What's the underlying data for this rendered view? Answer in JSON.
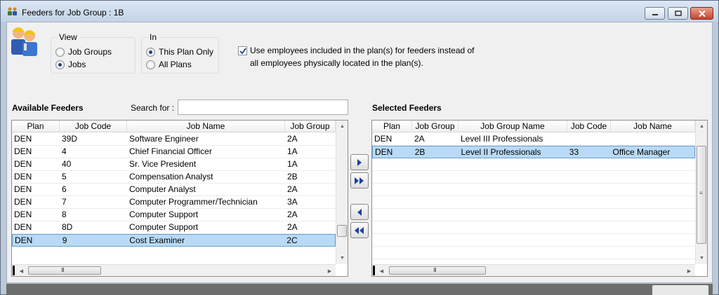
{
  "window": {
    "title": "Feeders for Job Group : 1B"
  },
  "view_group": {
    "title": "View",
    "options": [
      {
        "label": "Job Groups",
        "selected": false
      },
      {
        "label": "Jobs",
        "selected": true
      }
    ]
  },
  "in_group": {
    "title": "In",
    "options": [
      {
        "label": "This Plan Only",
        "selected": true
      },
      {
        "label": "All Plans",
        "selected": false
      }
    ]
  },
  "use_employees": {
    "checked": true,
    "line1": "Use employees included in the plan(s) for feeders instead of",
    "line2": "all employees physically located in the plan(s)."
  },
  "available": {
    "label": "Available Feeders",
    "search_label": "Search for :",
    "search_value": "",
    "columns": [
      "Plan",
      "Job Code",
      "Job Name",
      "Job Group"
    ],
    "rows": [
      {
        "plan": "DEN",
        "job_code": "39D",
        "job_name": "Software Engineer",
        "job_group": "2A",
        "selected": false
      },
      {
        "plan": "DEN",
        "job_code": "4",
        "job_name": "Chief Financial Officer",
        "job_group": "1A",
        "selected": false
      },
      {
        "plan": "DEN",
        "job_code": "40",
        "job_name": "Sr. Vice President",
        "job_group": "1A",
        "selected": false
      },
      {
        "plan": "DEN",
        "job_code": "5",
        "job_name": "Compensation Analyst",
        "job_group": "2B",
        "selected": false
      },
      {
        "plan": "DEN",
        "job_code": "6",
        "job_name": "Computer Analyst",
        "job_group": "2A",
        "selected": false
      },
      {
        "plan": "DEN",
        "job_code": "7",
        "job_name": "Computer Programmer/Technician",
        "job_group": "3A",
        "selected": false
      },
      {
        "plan": "DEN",
        "job_code": "8",
        "job_name": "Computer Support",
        "job_group": "2A",
        "selected": false
      },
      {
        "plan": "DEN",
        "job_code": "8D",
        "job_name": "Computer Support",
        "job_group": "2A",
        "selected": false
      },
      {
        "plan": "DEN",
        "job_code": "9",
        "job_name": "Cost Examiner",
        "job_group": "2C",
        "selected": true
      }
    ],
    "hscroll_grip": "III"
  },
  "selected": {
    "label": "Selected Feeders",
    "columns": [
      "Plan",
      "Job Group",
      "Job Group Name",
      "Job Code",
      "Job Name"
    ],
    "rows": [
      {
        "plan": "DEN",
        "job_group": "2A",
        "job_group_name": "Level III Professionals",
        "job_code": "",
        "job_name": "",
        "selected": false
      },
      {
        "plan": "DEN",
        "job_group": "2B",
        "job_group_name": "Level II Professionals",
        "job_code": "33",
        "job_name": "Office Manager",
        "selected": true
      }
    ],
    "hscroll_grip": "III",
    "vscroll_grip": "≡"
  },
  "icons": {
    "title": "people-group-icon",
    "logo": "workers-icon"
  },
  "colors": {
    "selection": "#b9daf6",
    "move_arrows": "#1f3fa0",
    "close_button": "#c7432c"
  }
}
